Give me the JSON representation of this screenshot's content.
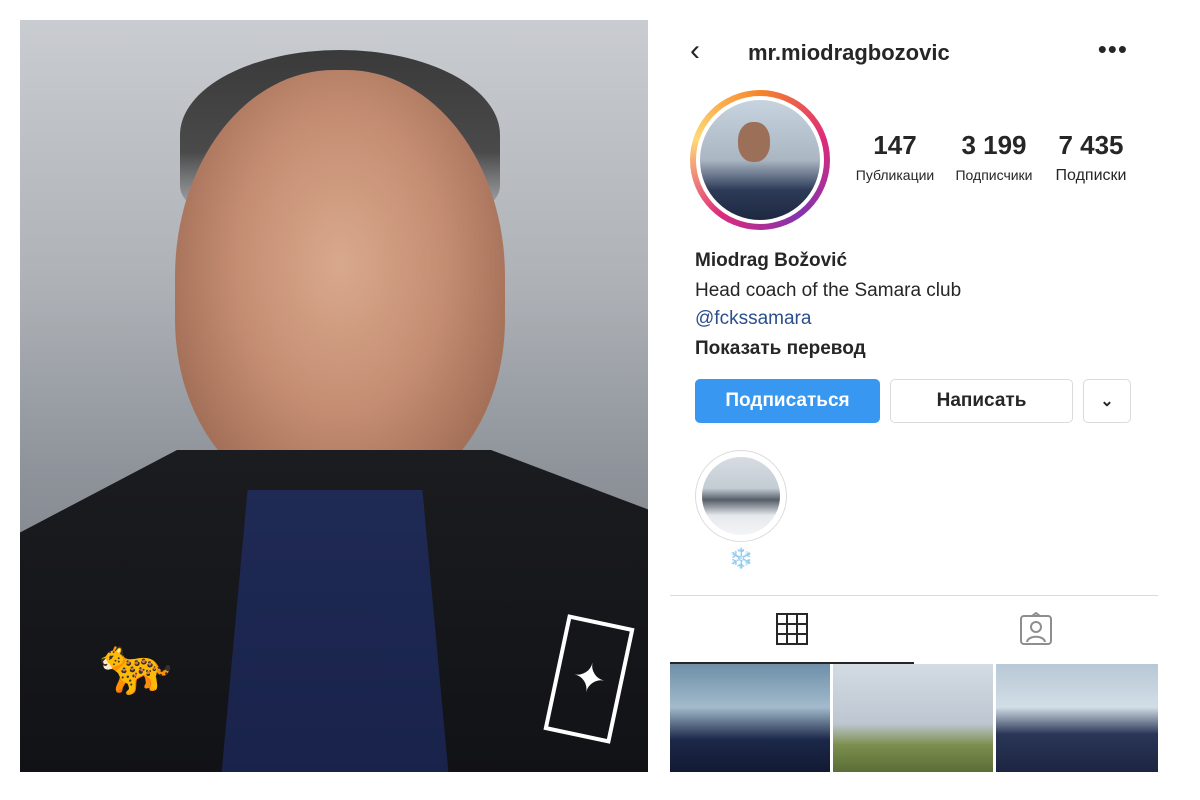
{
  "profile": {
    "username": "mr.miodragbozovic",
    "stats": [
      {
        "value": "147",
        "label": "Публикации"
      },
      {
        "value": "3 199",
        "label": "Подписчики"
      },
      {
        "value": "7 435",
        "label": "Подписки"
      }
    ],
    "name": "Miodrag Božović",
    "bio": "Head coach of the Samara club",
    "link": "@fckssamara",
    "translate": "Показать перевод"
  },
  "actions": {
    "follow": "Подписаться",
    "message": "Написать",
    "dropdown_icon": "chevron-down-icon"
  },
  "highlight": {
    "label": "❄️"
  },
  "tabs": [
    "grid-icon",
    "tagged-icon"
  ],
  "colors": {
    "follow_button": "#3897f0",
    "link": "#2b4e8c",
    "highlight_label": "#3d8fd9"
  }
}
